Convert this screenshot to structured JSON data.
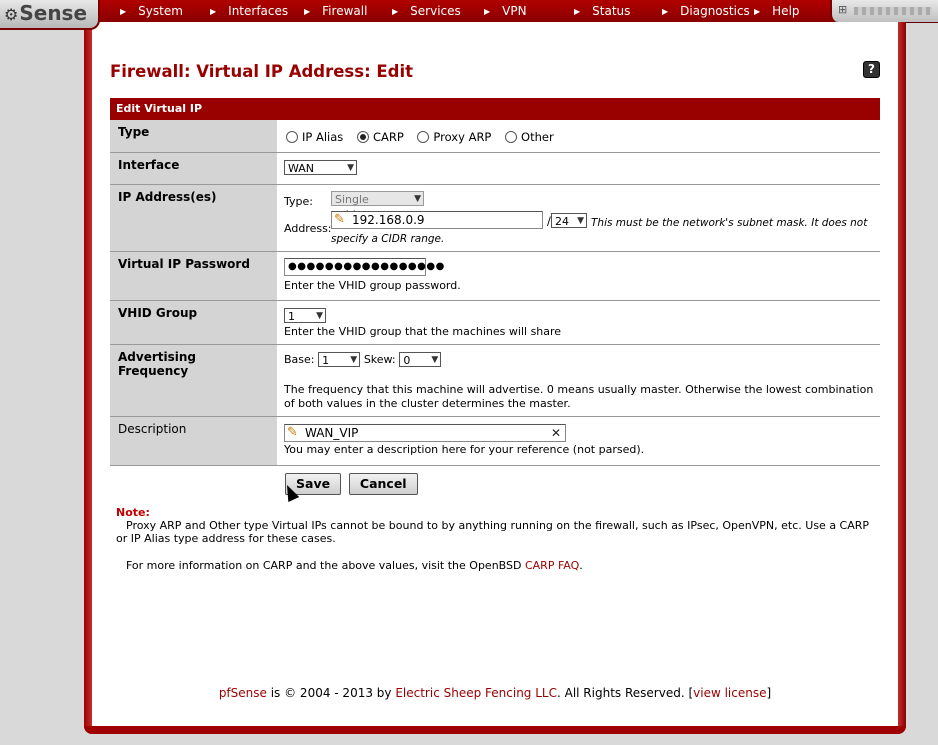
{
  "app": {
    "logo_text": "Sense"
  },
  "nav": {
    "items": [
      "System",
      "Interfaces",
      "Firewall",
      "Services",
      "VPN",
      "Status",
      "Diagnostics",
      "Help"
    ]
  },
  "page": {
    "title": "Firewall: Virtual IP Address: Edit",
    "help_label": "?"
  },
  "form": {
    "header": "Edit Virtual IP",
    "type": {
      "label": "Type",
      "options": [
        "IP Alias",
        "CARP",
        "Proxy ARP",
        "Other"
      ],
      "selected": "CARP"
    },
    "interface": {
      "label": "Interface",
      "value": "WAN"
    },
    "ip": {
      "label": "IP Address(es)",
      "type_label": "Type:",
      "type_value": "Single address",
      "address_label": "Address:",
      "address_value": "192.168.0.9",
      "slash": "/",
      "mask_value": "24",
      "hint": "This must be the network's subnet mask. It does not specify a CIDR range."
    },
    "password": {
      "label": "Virtual IP Password",
      "value": "●●●●●●●●●●●●●●●●●",
      "hint": "Enter the VHID group password."
    },
    "vhid": {
      "label": "VHID Group",
      "value": "1",
      "hint": "Enter the VHID group that the machines will share"
    },
    "advfreq": {
      "label": "Advertising Frequency",
      "base_label": "Base:",
      "base_value": "1",
      "skew_label": "Skew:",
      "skew_value": "0",
      "hint": "The frequency that this machine will advertise. 0 means usually master. Otherwise the lowest combination of both values in the cluster determines the master."
    },
    "description": {
      "label": "Description",
      "value": "WAN_VIP",
      "hint": "You may enter a description here for your reference (not parsed)."
    },
    "buttons": {
      "save": "Save",
      "cancel": "Cancel"
    }
  },
  "note": {
    "title": "Note:",
    "text1": "Proxy ARP and Other type Virtual IPs cannot be bound to by anything running on the firewall, such as IPsec, OpenVPN, etc. Use a CARP or IP Alias type address for these cases.",
    "text2_prefix": "For more information on CARP and the above values, visit the OpenBSD ",
    "text2_link": "CARP FAQ",
    "text2_suffix": "."
  },
  "footer": {
    "brand": "pfSense",
    "middle": " is © 2004 - 2013 by ",
    "company": "Electric Sheep Fencing LLC",
    "rights": ". All Rights Reserved. [",
    "license": "view license",
    "end": "]"
  }
}
